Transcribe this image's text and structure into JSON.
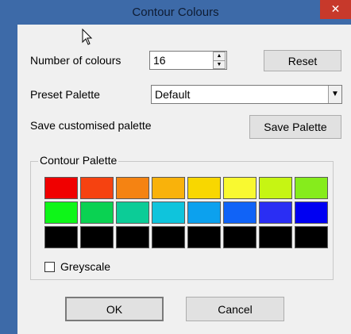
{
  "window": {
    "title": "Contour Colours",
    "close_glyph": "✕"
  },
  "form": {
    "num_colours_label": "Number of colours",
    "num_colours_value": "16",
    "reset_label": "Reset",
    "preset_label": "Preset Palette",
    "preset_value": "Default",
    "save_custom_label": "Save customised palette",
    "save_palette_label": "Save Palette"
  },
  "palette": {
    "title": "Contour Palette",
    "colors": [
      "#f00000",
      "#f64210",
      "#f58312",
      "#f9b20b",
      "#f8d700",
      "#f9f930",
      "#c6f513",
      "#86ec1c",
      "#0ef618",
      "#0ad252",
      "#0ccc97",
      "#0fc4dc",
      "#0ca1ee",
      "#1063f7",
      "#2a2ef4",
      "#0000f2",
      "#000000",
      "#000000",
      "#000000",
      "#000000",
      "#000000",
      "#000000",
      "#000000",
      "#000000"
    ],
    "greyscale_label": "Greyscale",
    "greyscale_checked": false
  },
  "footer": {
    "ok_label": "OK",
    "cancel_label": "Cancel"
  }
}
